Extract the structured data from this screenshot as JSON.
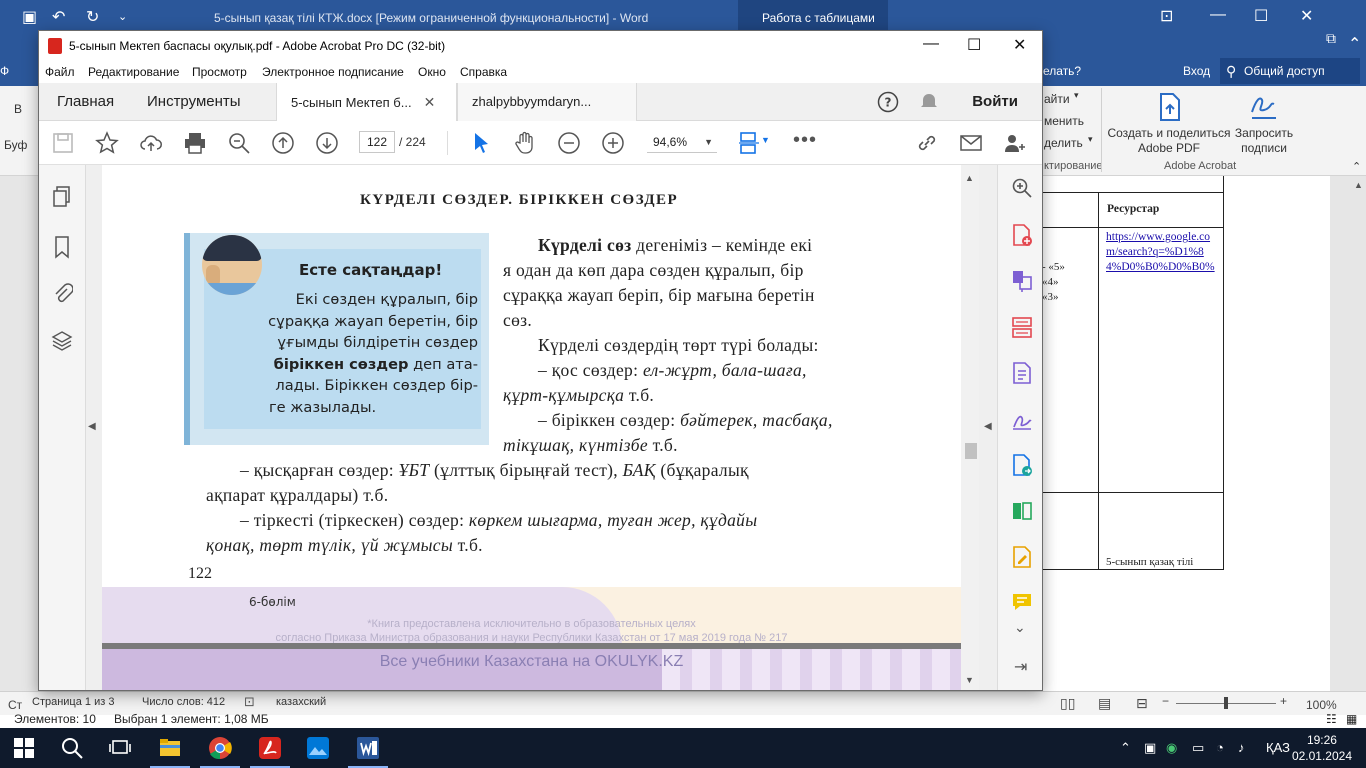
{
  "word": {
    "title": "5-сынып қазақ тілі КТЖ.docx [Режим ограниченной функциональности] - Word",
    "context_tab": "Работа с таблицами",
    "help_search": "елать?",
    "login": "Вход",
    "share": "Общий доступ",
    "ribbon_items": [
      "айти",
      "менить",
      "делить",
      "ктирование"
    ],
    "acrobat_group": "Adobe Acrobat",
    "create_share_pdf": "Создать и поделиться Adobe PDF",
    "request_signatures": "Запросить подписи",
    "left_fragments": [
      "Ф",
      "В",
      "Буф",
      "Ст"
    ],
    "table": {
      "header": "Ресурстар",
      "link": "https://www.google.com/search?q=%D1%84%D0%B0%D0%B0%",
      "grades": [
        "- «5»",
        "«4»",
        "«3»"
      ],
      "footer": "5-сынып қазақ тілі"
    },
    "status": {
      "zoom": "100%"
    },
    "explorer": {
      "elements": "Элементов: 10",
      "selected": "Выбран 1 элемент: 1,08 МБ"
    }
  },
  "acrobat": {
    "title": "5-сынып Мектеп баспасы оқулық.pdf - Adobe Acrobat Pro DC (32-bit)",
    "menu": [
      "Файл",
      "Редактирование",
      "Просмотр",
      "Электронное подписание",
      "Окно",
      "Справка"
    ],
    "tabs": {
      "home": "Главная",
      "tools": "Инструменты",
      "doc1": "5-сынып Мектеп б...",
      "doc2": "zhalpybbyymdaryn..."
    },
    "signin": "Войти",
    "page_current": "122",
    "page_total": "/  224",
    "zoom": "94,6%",
    "status": {
      "page": "Страница 1 из 3",
      "words": "Число слов: 412",
      "lang": "казахский"
    }
  },
  "pdf": {
    "heading": "КҮРДЕЛІ   СӨЗДЕР.   БІРІККЕН   СӨЗДЕР",
    "rule_title": "Есте сақтаңдар!",
    "rule_lines": [
      "Екі сөзден құралып, бір",
      "сұраққа жауап беретін, бір",
      "ұғымды білдіретін сөздер"
    ],
    "rule_bold": "біріккен сөздер",
    "rule_after_bold": " деп ата-",
    "rule_lines2": [
      "лады. Біріккен сөздер бір-",
      "ге жазылады."
    ],
    "p1_bold": "Күрделі сөз",
    "p1_rest": " дегеніміз  – кемінде  екі",
    "p2": "я одан да көп дара сөзден құралып,  бір",
    "p3": "сұраққа  жауап  беріп,  бір мағына  беретін",
    "p4": "сөз.",
    "p5": "Күрделі   сөздердің   төрт  түрі  болады:",
    "l1a": "– қос  сөздер:  ",
    "l1b": "ел-жұрт,   бала-шаға,",
    "l2a": "құрт-құмырсқа",
    "l2b": "      т.б.",
    "l3a": "– біріккен   сөздер: ",
    "l3b": "бәйтерек,   тасбақа,",
    "l4a": "тікұшақ,    күнтізбе",
    "l4b": "   т.б.",
    "l5a": "– қысқарған   сөздер:  ",
    "l5b": "ҰБТ",
    "l5c": "  (ұлттық  бірыңғай  тест),  ",
    "l5d": "БАҚ",
    "l5e": "  (бұқаралық",
    "l6": "ақпарат   құралдары)    т.б.",
    "l7a": "– тіркесті   (тіркескен)    сөздер:  ",
    "l7b": "көркем   шығарма,    туған   жер, құдайы",
    "l8a": "қонақ,    төрт  түлік,    үй  жұмысы",
    "l8b": "   т.б.",
    "page_number": "122",
    "section": "6-бөлім",
    "watermark1": "*Книга предоставлена исключительно в образовательных целях",
    "watermark2": "согласно Приказа Министра образования и науки Республики Казахстан от 17 мая 2019 года № 217",
    "watermark3": "Все учебники Казахстана на OKULYK.KZ"
  },
  "taskbar": {
    "lang": "ҚАЗ",
    "time": "19:26",
    "date": "02.01.2024"
  }
}
